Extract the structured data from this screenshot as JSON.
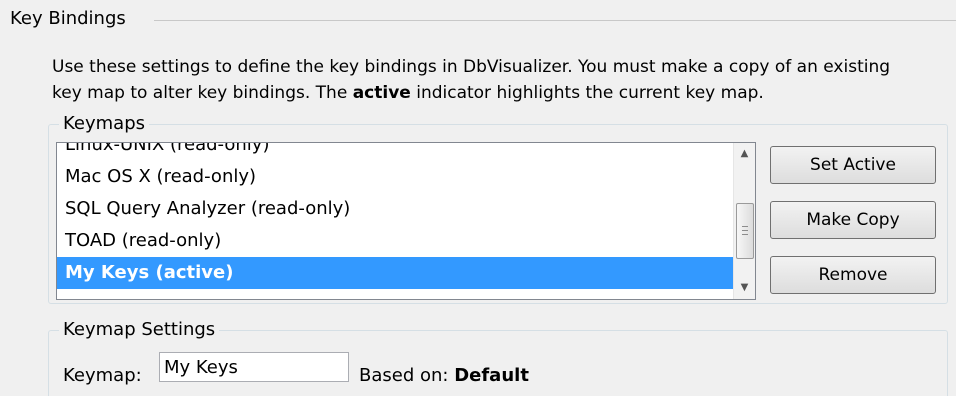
{
  "key_bindings": {
    "title": "Key Bindings",
    "description_line1": "Use these settings to define the key bindings in DbVisualizer. You must make a copy of an existing",
    "description_line2_pre": "key map to alter key bindings. The ",
    "description_line2_bold": "active",
    "description_line2_post": " indicator highlights the current key map."
  },
  "keymaps": {
    "legend": "Keymaps",
    "items": [
      {
        "label": "Linux-UNIX  (read-only)"
      },
      {
        "label": "Mac OS X  (read-only)"
      },
      {
        "label": "SQL Query Analyzer  (read-only)"
      },
      {
        "label": "TOAD  (read-only)"
      },
      {
        "label": "My Keys  (active)",
        "selected": true
      }
    ],
    "buttons": {
      "set_active": "Set Active",
      "make_copy": "Make Copy",
      "remove": "Remove"
    },
    "scroll_up_icon": "scroll-up-arrow",
    "scroll_down_icon": "scroll-down-arrow"
  },
  "keymap_settings": {
    "legend": "Keymap Settings",
    "keymap_label": "Keymap:",
    "keymap_value": "My Keys",
    "based_on_label": "Based on:",
    "based_on_value": "Default"
  },
  "colors": {
    "selection": "#3399ff",
    "window_bg": "#f0f0f0"
  }
}
